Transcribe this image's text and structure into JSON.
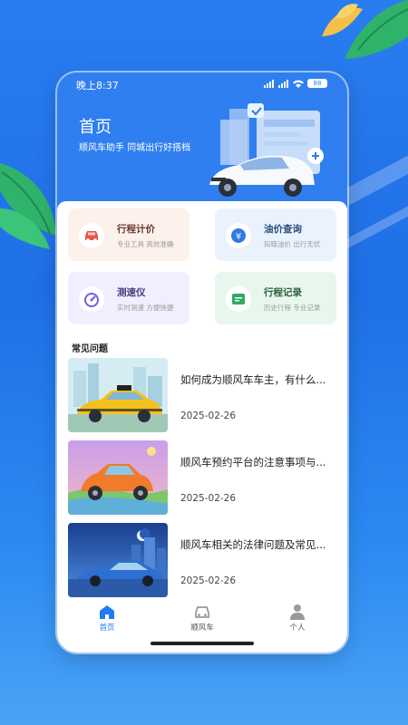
{
  "status_bar": {
    "time": "晚上8:37",
    "battery": "88"
  },
  "header": {
    "title": "首页",
    "subtitle": "顺风车助手  同城出行好搭档"
  },
  "tiles": [
    {
      "name": "行程计价",
      "desc": "专业工具  高效准确",
      "icon": "car-icon",
      "bg": "#fdf1ec",
      "accent": "#e2574c",
      "text_color": "#6b3a2f"
    },
    {
      "name": "油价查询",
      "desc": "知晓油价  出行无忧",
      "icon": "fuel-price-icon",
      "bg": "#eaf3fd",
      "accent": "#2d7be3",
      "text_color": "#2a4f7a"
    },
    {
      "name": "测速仪",
      "desc": "实时测速  方便快捷",
      "icon": "speedometer-icon",
      "bg": "#f1efff",
      "accent": "#7a5de0",
      "text_color": "#4a3c7a"
    },
    {
      "name": "行程记录",
      "desc": "历史行程  专业记录",
      "icon": "record-icon",
      "bg": "#e8f7ee",
      "accent": "#2fa964",
      "text_color": "#2b6040"
    }
  ],
  "faq": {
    "heading": "常见问题",
    "items": [
      {
        "title": "如何成为顺风车车主，有什么...",
        "date": "2025-02-26",
        "thumb": "taxi-image"
      },
      {
        "title": "顺风车预约平台的注意事项与...",
        "date": "2025-02-26",
        "thumb": "orange-car-image"
      },
      {
        "title": "顺风车相关的法律问题及常见...",
        "date": "2025-02-26",
        "thumb": "blue-car-image"
      }
    ]
  },
  "tabs": [
    {
      "label": "首页",
      "icon": "home-icon",
      "active": true
    },
    {
      "label": "顺风车",
      "icon": "car-icon",
      "active": false
    },
    {
      "label": "个人",
      "icon": "user-icon",
      "active": false
    }
  ],
  "colors": {
    "primary": "#1f7cf0",
    "background": "#2a7df0"
  }
}
